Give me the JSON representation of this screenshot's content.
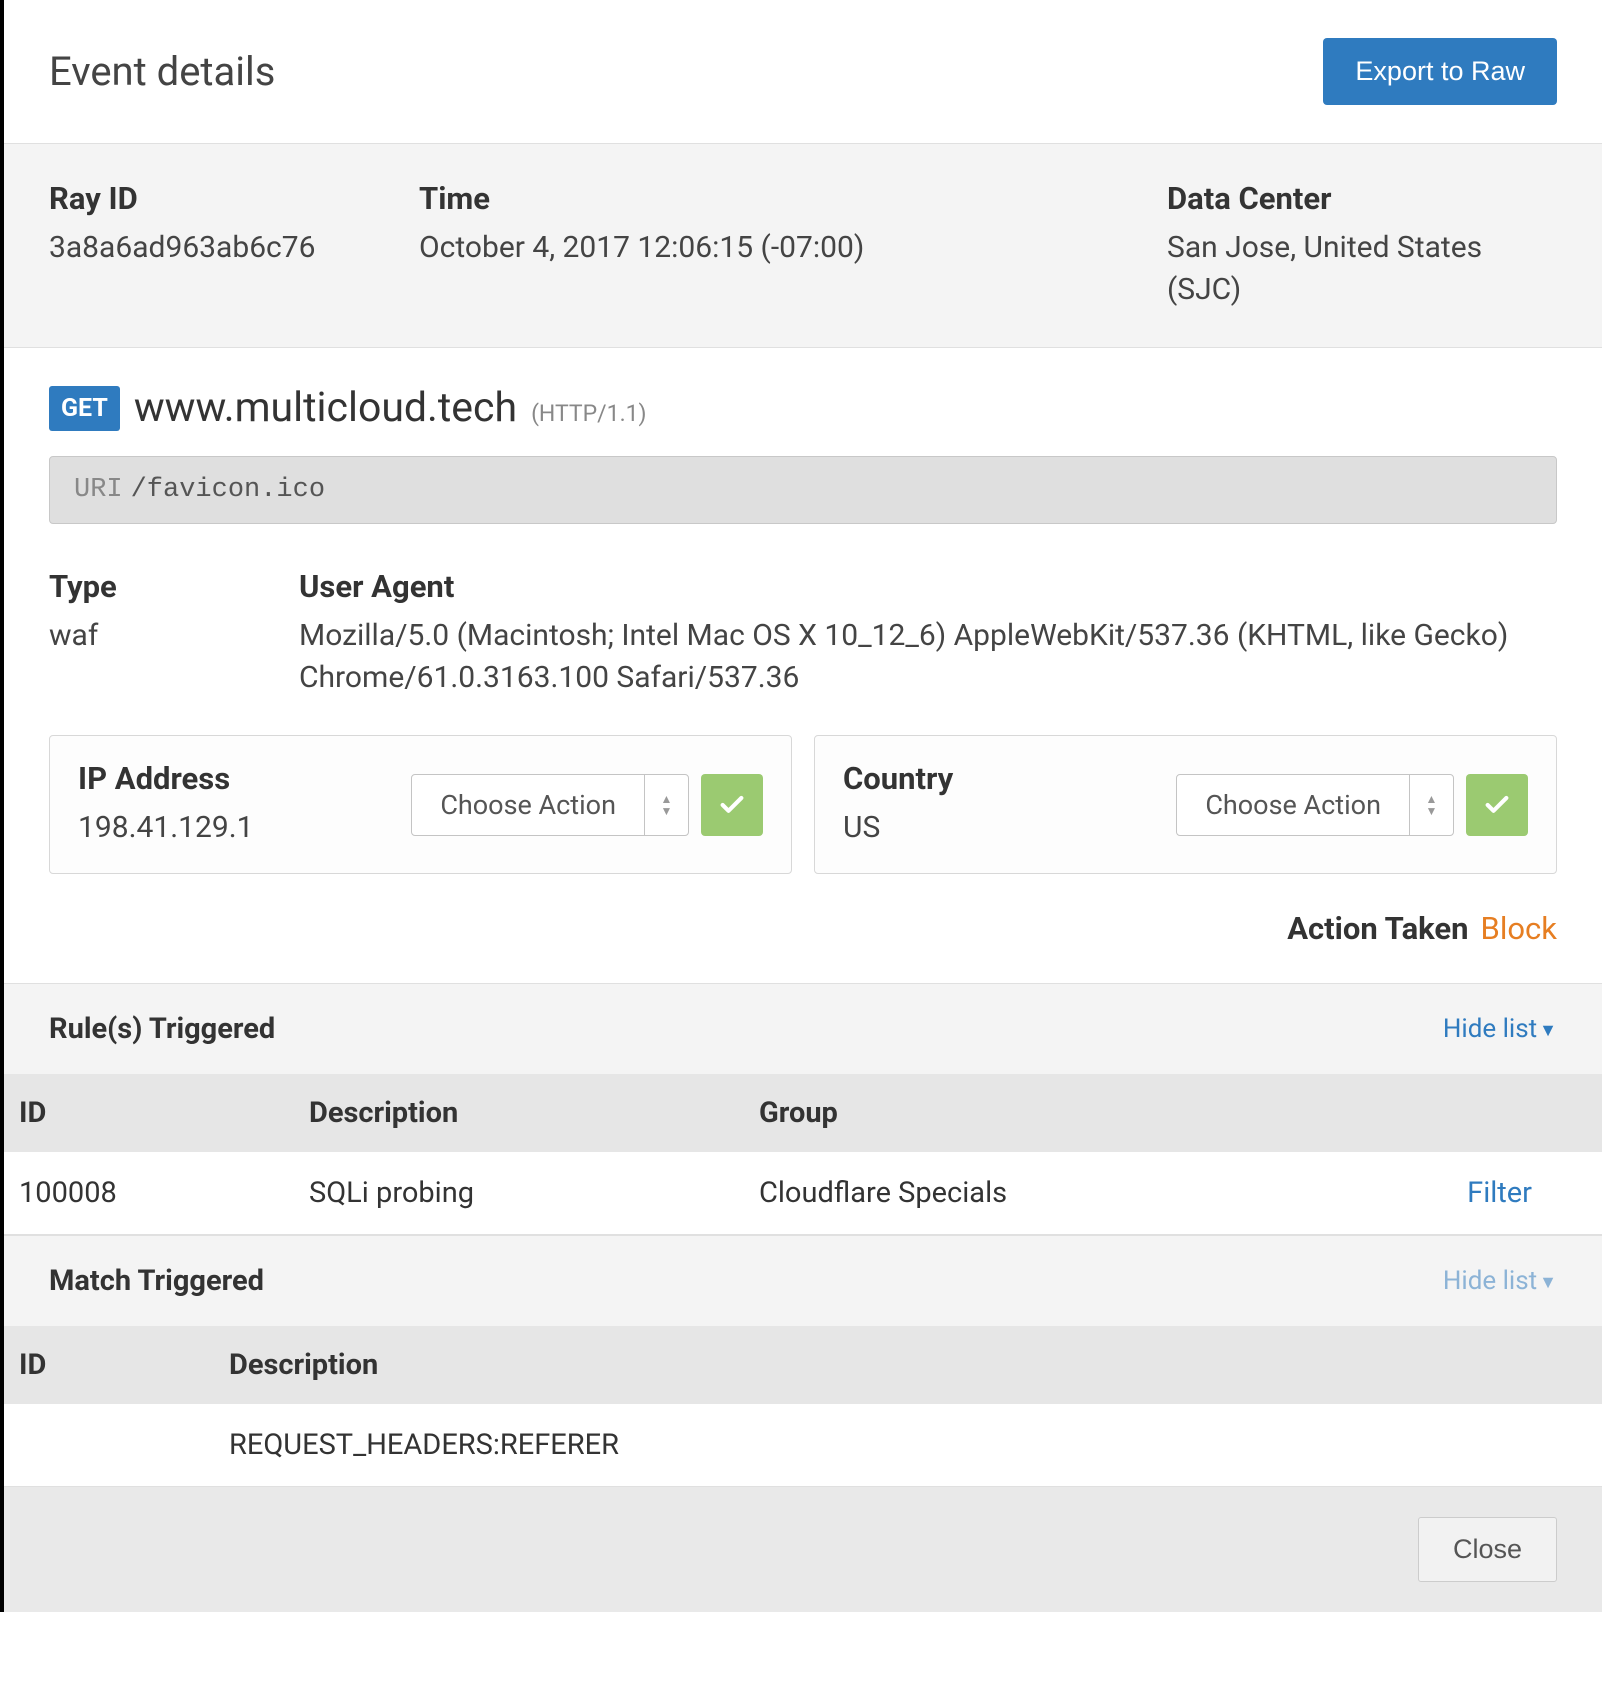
{
  "header": {
    "title": "Event details",
    "export_btn": "Export to Raw"
  },
  "meta": {
    "ray_label": "Ray ID",
    "ray_value": "3a8a6ad963ab6c76",
    "time_label": "Time",
    "time_value": "October 4, 2017 12:06:15 (-07:00)",
    "dc_label": "Data Center",
    "dc_value": "San Jose, United States (SJC)"
  },
  "request": {
    "method": "GET",
    "host": "www.multicloud.tech",
    "protocol": "(HTTP/1.1)",
    "uri_label": "URI",
    "uri_value": "/favicon.ico"
  },
  "details": {
    "type_label": "Type",
    "type_value": "waf",
    "ua_label": "User Agent",
    "ua_value": "Mozilla/5.0 (Macintosh; Intel Mac OS X 10_12_6) AppleWebKit/537.36 (KHTML, like Gecko) Chrome/61.0.3163.100 Safari/537.36"
  },
  "actions": {
    "ip_label": "IP Address",
    "ip_value": "198.41.129.1",
    "ip_dropdown": "Choose Action",
    "country_label": "Country",
    "country_value": "US",
    "country_dropdown": "Choose Action",
    "taken_label": "Action Taken",
    "taken_value": "Block"
  },
  "rules": {
    "section_title": "Rule(s) Triggered",
    "hide_list": "Hide list",
    "cols": {
      "id": "ID",
      "desc": "Description",
      "group": "Group"
    },
    "rows": [
      {
        "id": "100008",
        "desc": "SQLi probing",
        "group": "Cloudflare Specials",
        "filter": "Filter"
      }
    ]
  },
  "match": {
    "section_title": "Match Triggered",
    "hide_list": "Hide list",
    "cols": {
      "id": "ID",
      "desc": "Description"
    },
    "rows": [
      {
        "id": "",
        "desc": "REQUEST_HEADERS:REFERER"
      }
    ]
  },
  "footer": {
    "close": "Close"
  }
}
